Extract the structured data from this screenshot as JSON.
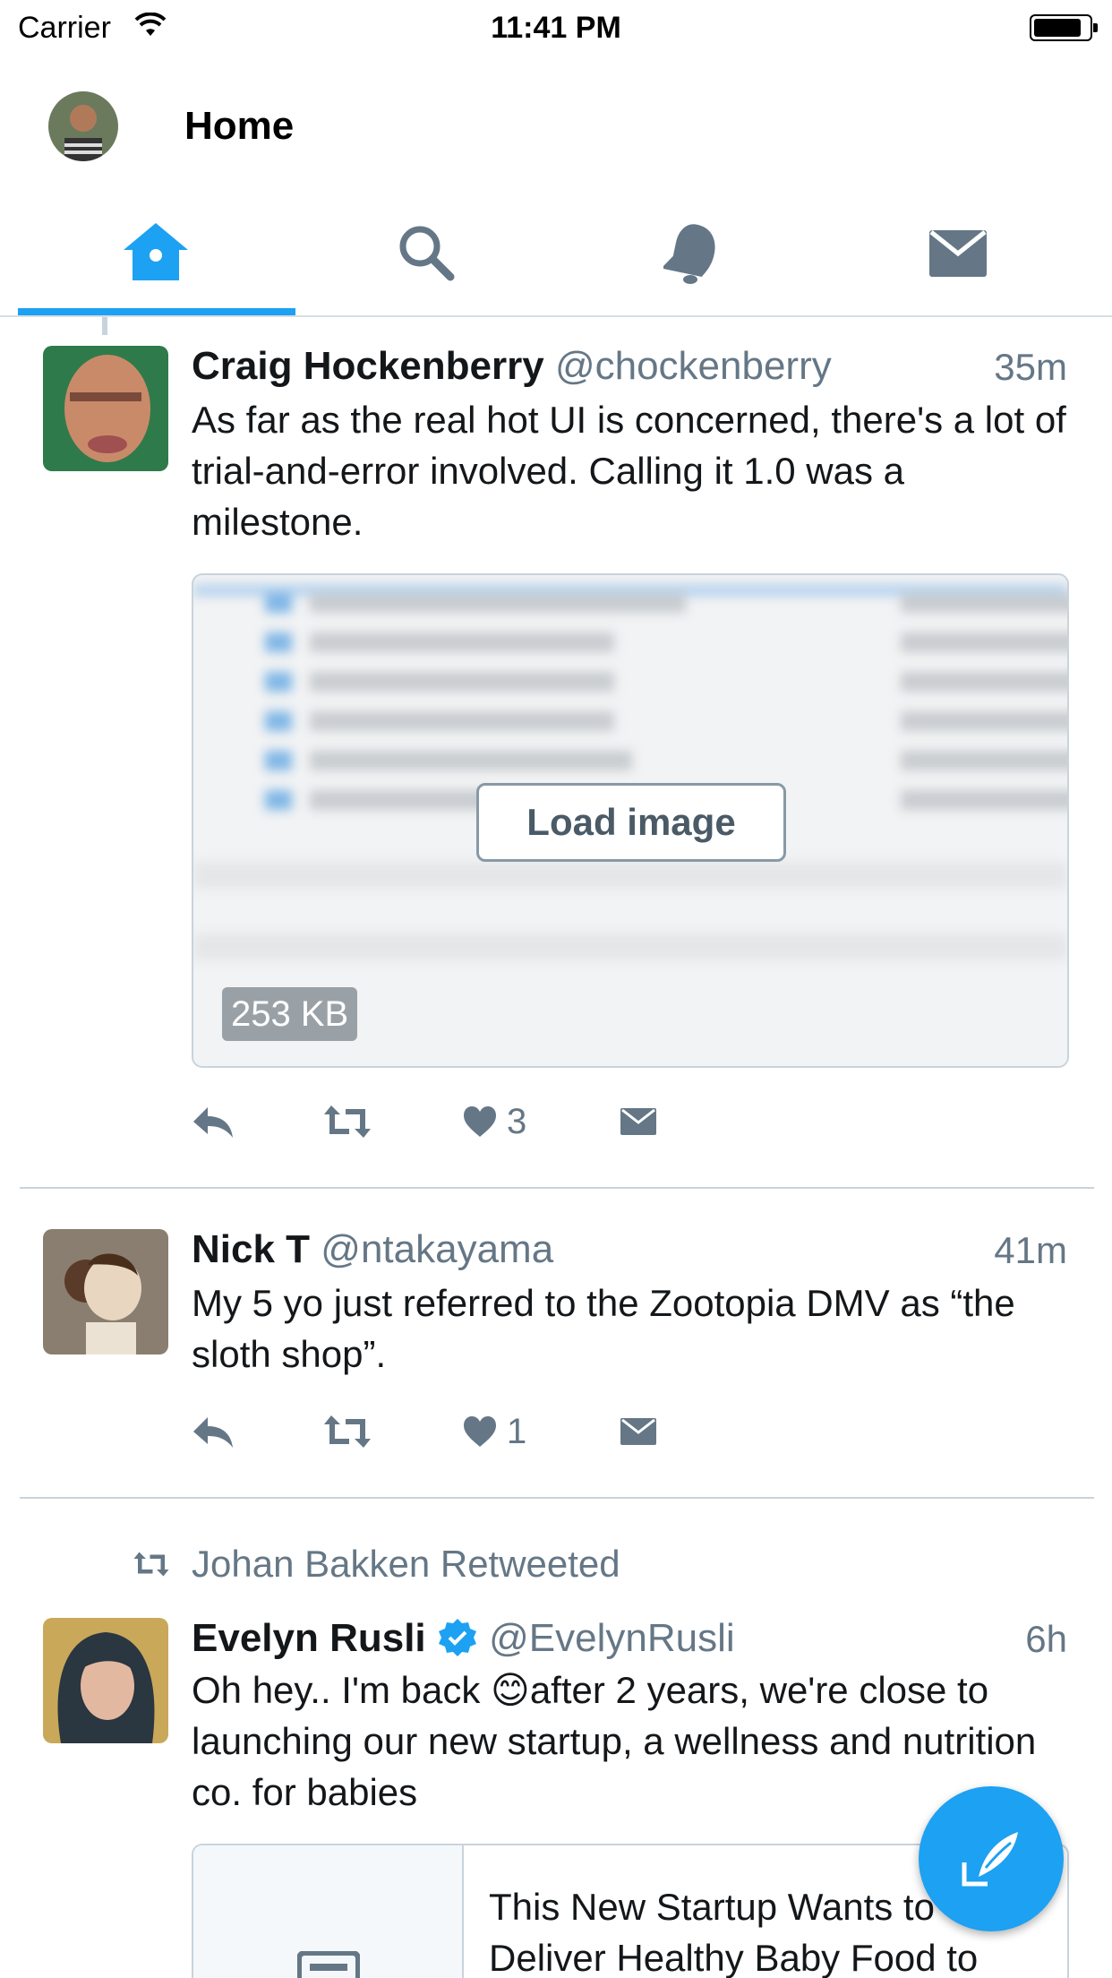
{
  "status_bar": {
    "carrier": "Carrier",
    "time": "11:41 PM"
  },
  "header": {
    "title": "Home"
  },
  "tabs": [
    {
      "name": "home",
      "icon": "home-icon",
      "active": true
    },
    {
      "name": "search",
      "icon": "search-icon",
      "active": false
    },
    {
      "name": "notifications",
      "icon": "bell-icon",
      "active": false
    },
    {
      "name": "messages",
      "icon": "envelope-icon",
      "active": false
    }
  ],
  "colors": {
    "accent": "#1da1f2",
    "secondary_text": "#657786",
    "divider": "#c9d3dc"
  },
  "tweets": [
    {
      "name": "Craig Hockenberry",
      "handle": "@chockenberry",
      "time": "35m",
      "text": "As far as the real hot UI is concerned, there's a lot of trial-and-error involved. Calling it 1.0 was a milestone.",
      "media": {
        "button_label": "Load image",
        "size": "253 KB"
      },
      "likes": "3"
    },
    {
      "name": "Nick T",
      "handle": "@ntakayama",
      "time": "41m",
      "text": "My 5 yo just referred to the Zootopia DMV as “the sloth shop”.",
      "likes": "1"
    },
    {
      "retweeted_by": "Johan Bakken Retweeted",
      "name": "Evelyn Rusli",
      "verified": true,
      "handle": "@EvelynRusli",
      "time": "6h",
      "text_before_emoji": "Oh hey.. I'm back ",
      "emoji": "😊",
      "text_after_emoji": "after 2 years, we're close to launching our new startup, a wellness and nutrition co. for babies",
      "card_title": "This New Startup Wants to Deliver Healthy Baby Food to"
    }
  ]
}
